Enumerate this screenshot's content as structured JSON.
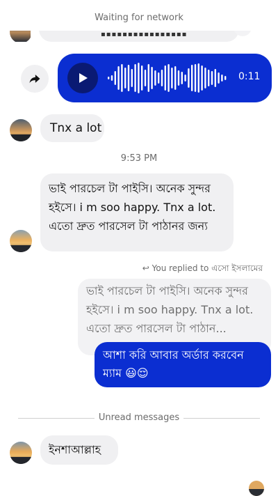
{
  "status": {
    "text": "Waiting for network"
  },
  "voice_message": {
    "duration": "0:11"
  },
  "messages": {
    "tnx": "Tnx a lot",
    "time_divider": "9:53 PM",
    "long_text": "ভাই পারচেল টা  পাইসি। অনেক সুন্দর হইসে। i m soo happy. Tnx a lot. এতো দ্রুত পারসেল টা পাঠানর জন্য",
    "replied_note": "You replied to এসো ইসলামের",
    "quoted_text": "ভাই পারচেল টা  পাইসি। অনেক সুন্দর হইসে। i m soo happy. Tnx a lot. এতো দ্রুত পারসেল টা পাঠান...",
    "reply_text": "আশা করি আবার অর্ডার করবেন ম্যাম 😃😌",
    "unread_label": "Unread messages",
    "last_text": "ইনশাআল্লাহ"
  },
  "colors": {
    "accent": "#0b2ed1",
    "bubble_in": "#f0f0f2",
    "muted_text": "#6b6b6b"
  },
  "icons": {
    "forward": "share-arrow-icon",
    "play": "play-icon",
    "reply": "reply-arrow-icon"
  }
}
